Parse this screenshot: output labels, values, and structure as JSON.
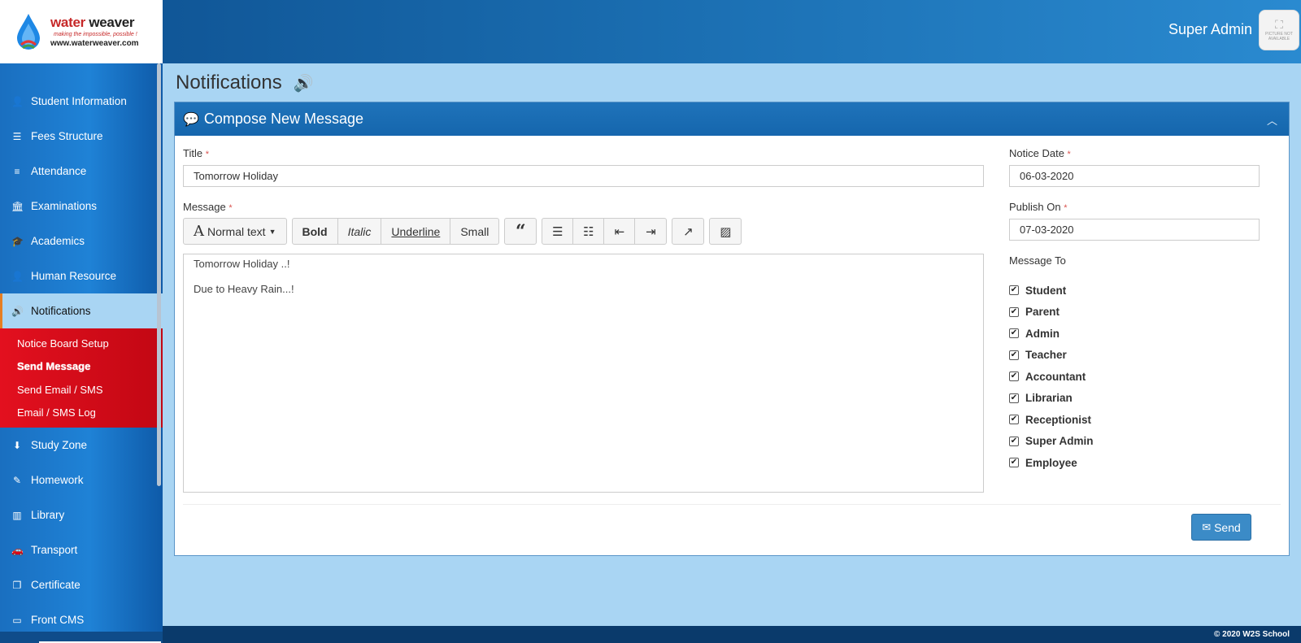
{
  "header": {
    "logo_title_part1": "water",
    "logo_title_part2": "weaver",
    "logo_tagline": "making the impossible, possible !",
    "logo_url": "www.waterweaver.com",
    "user_name": "Super Admin",
    "avatar_text": "PICTURE NOT AVAILABLE"
  },
  "sidebar": {
    "items": [
      {
        "label": "Student Information",
        "icon": "user-icon"
      },
      {
        "label": "Fees Structure",
        "icon": "database-icon"
      },
      {
        "label": "Attendance",
        "icon": "list-icon"
      },
      {
        "label": "Examinations",
        "icon": "bank-icon"
      },
      {
        "label": "Academics",
        "icon": "graduation-cap-icon"
      },
      {
        "label": "Human Resource",
        "icon": "user-icon"
      },
      {
        "label": "Notifications",
        "icon": "volume-icon",
        "active": true
      },
      {
        "label": "Study Zone",
        "icon": "download-icon"
      },
      {
        "label": "Homework",
        "icon": "edit-icon"
      },
      {
        "label": "Library",
        "icon": "barcode-icon"
      },
      {
        "label": "Transport",
        "icon": "car-icon"
      },
      {
        "label": "Certificate",
        "icon": "copy-icon"
      },
      {
        "label": "Front CMS",
        "icon": "screen-icon"
      }
    ],
    "submenu": [
      {
        "label": "Notice Board Setup"
      },
      {
        "label": "Send Message",
        "current": true
      },
      {
        "label": "Send Email / SMS"
      },
      {
        "label": "Email / SMS Log"
      }
    ]
  },
  "main": {
    "page_title": "Notifications",
    "panel_title": "Compose New Message",
    "form": {
      "title_label": "Title",
      "title_value": "Tomorrow Holiday",
      "message_label": "Message",
      "notice_date_label": "Notice Date",
      "notice_date_value": "06-03-2020",
      "publish_on_label": "Publish On",
      "publish_on_value": "07-03-2020",
      "message_to_label": "Message To",
      "required_mark": "*"
    },
    "toolbar": {
      "font_style": "Normal text",
      "bold": "Bold",
      "italic": "Italic",
      "underline": "Underline",
      "small": "Small"
    },
    "editor": {
      "line1": "Tomorrow Holiday ..!",
      "line2": "Due to Heavy Rain...!"
    },
    "recipients": [
      "Student",
      "Parent",
      "Admin",
      "Teacher",
      "Accountant",
      "Librarian",
      "Receptionist",
      "Super Admin",
      "Employee"
    ],
    "send_label": "Send"
  },
  "footer": {
    "copyright": "© 2020 W2S School"
  },
  "colors": {
    "header_blue": "#1a6db0",
    "submenu_red": "#e3101f",
    "page_bg": "#a9d5f3",
    "send_button": "#3b8bc7"
  }
}
